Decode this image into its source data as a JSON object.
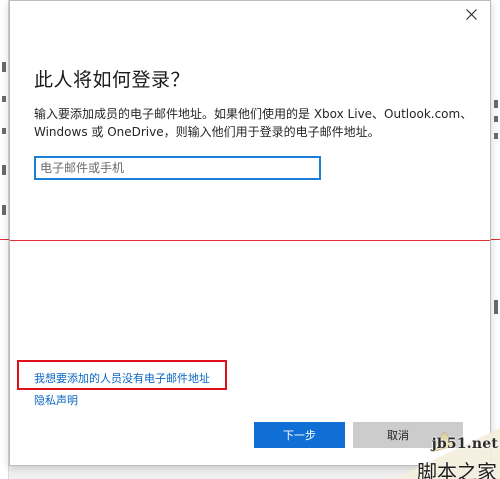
{
  "dialog": {
    "title": "此人将如何登录？",
    "description": "输入要添加成员的电子邮件地址。如果他们使用的是 Xbox Live、Outlook.com、Windows 或 OneDrive，则输入他们用于登录的电子邮件地址。",
    "email_input": {
      "placeholder": "电子邮件或手机",
      "value": ""
    },
    "no_email_link": "我想要添加的人员没有电子邮件地址",
    "privacy_link": "隐私声明",
    "next_button": "下一步",
    "cancel_button": "取消",
    "close_icon": "close-icon"
  },
  "watermark": {
    "url": "jb51.net",
    "brand": "脚本之家"
  },
  "colors": {
    "accent_blue": "#0f6fd4",
    "link_blue": "#0a66c2",
    "input_border": "#1b7fd6",
    "highlight_red": "#e00f1a"
  }
}
